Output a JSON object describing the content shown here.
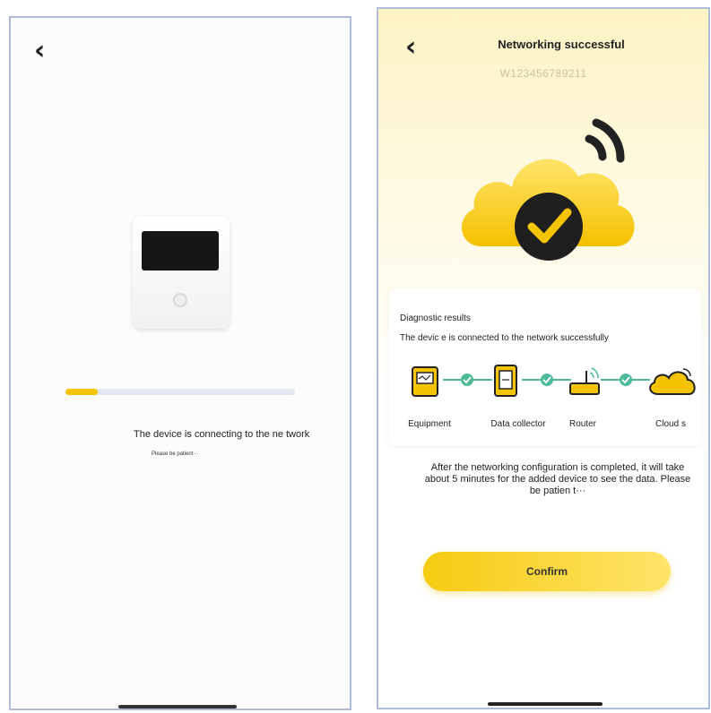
{
  "left_screen": {
    "back_glyph": "‹",
    "progress": 0.14,
    "status_text": "The device is connecting to the ne twork",
    "patient_text": "Please be patient···"
  },
  "right_screen": {
    "back_glyph": "‹",
    "title": "Networking successful",
    "serial": "W123456789211",
    "diagnostic_title": "Diagnostic results",
    "diagnostic_status": "The devic e is connected to the network successfully",
    "chain": [
      {
        "label": "Equipment",
        "icon": "inverter-icon"
      },
      {
        "label": "Data collector",
        "icon": "data-collector-icon"
      },
      {
        "label": "Router",
        "icon": "router-icon"
      },
      {
        "label": "Cloud s",
        "icon": "cloud-icon"
      }
    ],
    "explain_text": "After the networking configuration is completed, it will take about 5 minutes for the added device to see the data. Please be patien t···",
    "confirm_label": "Confirm"
  },
  "colors": {
    "accent": "#f5c400",
    "check_green": "#4dbb9a",
    "badge_dark": "#1f1f1f"
  }
}
